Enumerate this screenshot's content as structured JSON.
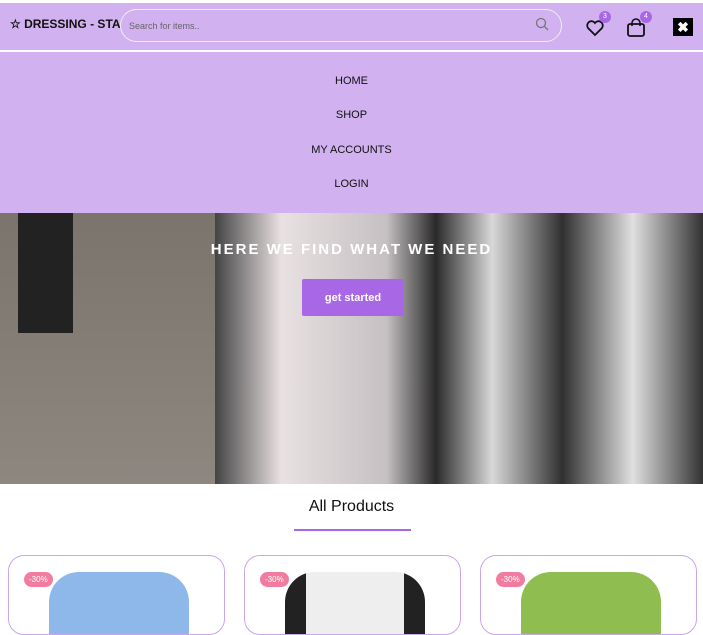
{
  "header": {
    "logo": "☆ DRESSING - STAR",
    "search_placeholder": "Search for items..",
    "wishlist_count": "3",
    "cart_count": "4",
    "close": "✖"
  },
  "nav": [
    {
      "label": "HOME"
    },
    {
      "label": "SHOP"
    },
    {
      "label": "MY ACCOUNTS"
    },
    {
      "label": "LOGIN"
    }
  ],
  "hero": {
    "title": "HERE WE FIND WHAT WE NEED",
    "button": "get started"
  },
  "products": {
    "title": "All Products",
    "items": [
      {
        "discount": "-30%",
        "color": "#8fb8ea"
      },
      {
        "discount": "-30%",
        "color": "#eeeeee"
      },
      {
        "discount": "-30%",
        "color": "#8fbd4f"
      }
    ]
  },
  "colors": {
    "accent": "#a868e6",
    "header_bg": "#d1b1ef",
    "discount": "#f27c9f"
  }
}
